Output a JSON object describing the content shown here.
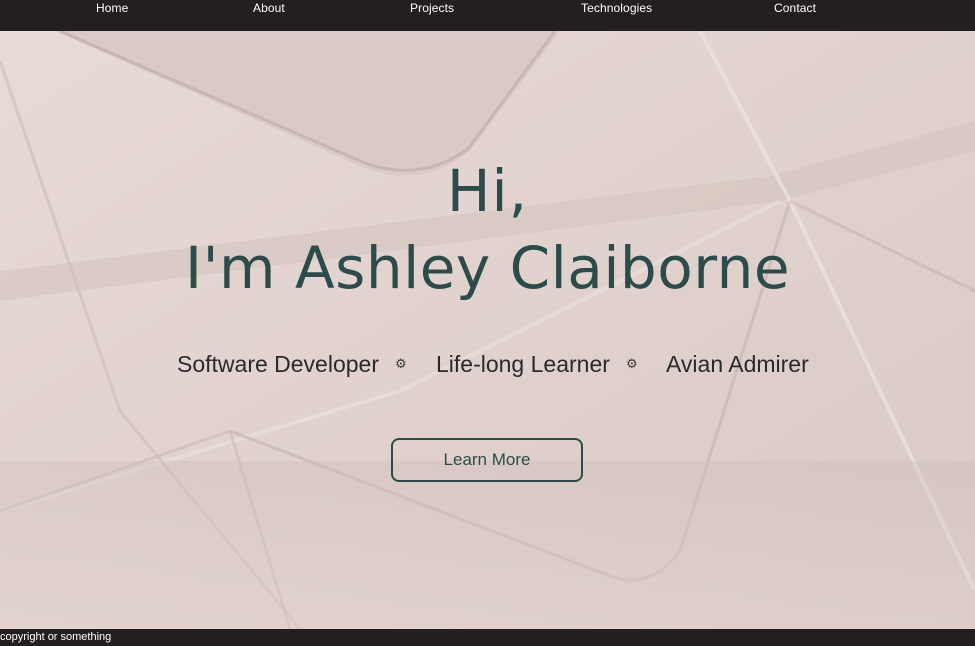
{
  "nav": {
    "items": [
      {
        "label": "Home"
      },
      {
        "label": "About"
      },
      {
        "label": "Projects"
      },
      {
        "label": "Technologies"
      },
      {
        "label": "Contact"
      }
    ]
  },
  "hero": {
    "greeting": "Hi,",
    "name": "I'm Ashley Claiborne",
    "taglines": [
      "Software Developer",
      "Life-long Learner",
      "Avian Admirer"
    ],
    "separator_icon": "gear-icon",
    "button_label": "Learn More"
  },
  "footer": {
    "copyright": "copyright or something"
  },
  "colors": {
    "nav_bg": "#231f20",
    "accent": "#2b4c4a",
    "hero_bg": "#e2d3cf"
  }
}
